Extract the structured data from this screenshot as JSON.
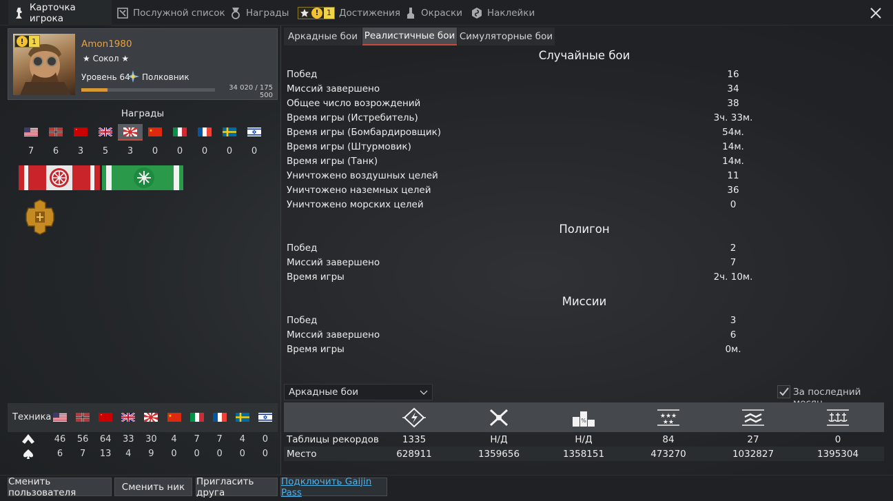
{
  "top_tabs": [
    {
      "label": "Карточка игрока",
      "icon": "player-card-icon"
    },
    {
      "label": "Послужной список",
      "icon": "service-record-icon"
    },
    {
      "label": "Награды",
      "icon": "medal-icon"
    },
    {
      "label": "Достижения",
      "icon": "achievements-icon",
      "badge": "1"
    },
    {
      "label": "Окраски",
      "icon": "paint-icon"
    },
    {
      "label": "Наклейки",
      "icon": "decal-icon"
    }
  ],
  "profile": {
    "badge": "1",
    "username": "Amon1980",
    "title": "★ Сокол ★",
    "level": "Уровень 64",
    "rank": "Полковник",
    "xp": "34 020 / 175 500",
    "xp_fraction": 0.194
  },
  "awards": {
    "title": "Награды",
    "flags": [
      "usa",
      "germany",
      "ussr",
      "britain",
      "japan",
      "china",
      "italy",
      "france",
      "sweden",
      "israel"
    ],
    "counts": [
      "7",
      "6",
      "3",
      "5",
      "3",
      "0",
      "0",
      "0",
      "0",
      "0"
    ],
    "selected": "japan"
  },
  "vehicles": {
    "label": "Техника",
    "air": [
      "46",
      "56",
      "64",
      "33",
      "30",
      "4",
      "7",
      "7",
      "4",
      "0"
    ],
    "ground": [
      "6",
      "7",
      "13",
      "4",
      "9",
      "0",
      "0",
      "0",
      "0",
      "0"
    ]
  },
  "game_tabs": [
    "Аркадные бои",
    "Реалистичные бои",
    "Симуляторные бои"
  ],
  "active_game_tab": 1,
  "sections": [
    {
      "title": "Случайные бои",
      "rows": [
        [
          "Побед",
          "16"
        ],
        [
          "Миссий завершено",
          "34"
        ],
        [
          "Общее число возрождений",
          "38"
        ],
        [
          "Время игры (Истребитель)",
          "3ч. 33м."
        ],
        [
          "Время игры (Бомбардировщик)",
          "54м."
        ],
        [
          "Время игры (Штурмовик)",
          "14м."
        ],
        [
          "Время игры (Танк)",
          "14м."
        ],
        [
          "Уничтожено воздушных целей",
          "11"
        ],
        [
          "Уничтожено наземных целей",
          "36"
        ],
        [
          "Уничтожено морских целей",
          "0"
        ]
      ]
    },
    {
      "title": "Полигон",
      "rows": [
        [
          "Побед",
          "2"
        ],
        [
          "Миссий завершено",
          "7"
        ],
        [
          "Время игры",
          "2ч. 10м."
        ]
      ]
    },
    {
      "title": "Миссии",
      "rows": [
        [
          "Побед",
          "3"
        ],
        [
          "Миссий завершено",
          "6"
        ],
        [
          "Время игры",
          "0м."
        ]
      ]
    }
  ],
  "leaderboard": {
    "mode_select": "Аркадные бои",
    "last_month_label": "За последний месяц",
    "last_month_checked": true,
    "icons": [
      "efficiency-icon",
      "kills-icon",
      "placement-icon",
      "air-kills-icon",
      "ground-kills-icon",
      "naval-icon"
    ],
    "rows": [
      {
        "label": "Таблицы рекордов",
        "values": [
          "1335",
          "Н/Д",
          "Н/Д",
          "84",
          "27",
          "0"
        ]
      },
      {
        "label": "Место",
        "values": [
          "628911",
          "1359656",
          "1358151",
          "473270",
          "1032827",
          "1395304"
        ]
      }
    ]
  },
  "bottom_buttons": [
    "Сменить пользователя",
    "Сменить ник",
    "Пригласить друга",
    "Подключить Gaijin Pass"
  ]
}
